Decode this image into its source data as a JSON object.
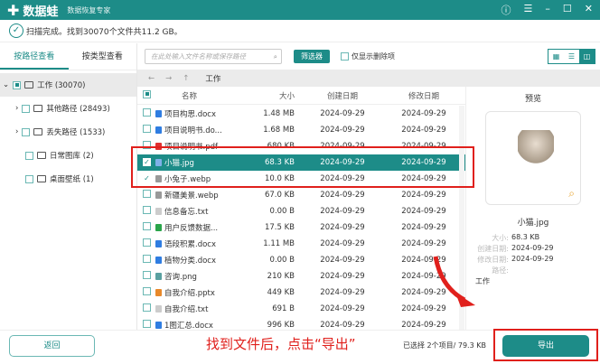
{
  "app": {
    "name": "数据蛙",
    "subtitle": "数据恢复专家"
  },
  "status": "扫描完成。找到30070个文件共11.2 GB。",
  "tabs": [
    "按路径查看",
    "按类型查看"
  ],
  "tree": [
    {
      "label": "工作 (30070)"
    },
    {
      "label": "其他路径 (28493)"
    },
    {
      "label": "丢失路径 (1533)"
    },
    {
      "label": "日常图库 (2)"
    },
    {
      "label": "桌面壁纸 (1)"
    }
  ],
  "toolbar": {
    "search_placeholder": "在此处输入文件名称或保存路径",
    "filter": "筛选器",
    "only_deleted": "仅显示删除项"
  },
  "breadcrumb": "工作",
  "columns": [
    "名称",
    "大小",
    "创建日期",
    "修改日期"
  ],
  "files": [
    {
      "name": "项目构思.docx",
      "size": "1.48 MB",
      "created": "2024-09-29",
      "modified": "2024-09-29",
      "color": "#2f7de1",
      "checked": false
    },
    {
      "name": "项目说明书.do...",
      "size": "1.68 MB",
      "created": "2024-09-29",
      "modified": "2024-09-29",
      "color": "#2f7de1",
      "checked": false
    },
    {
      "name": "项目说明书.pdf",
      "size": "680 KB",
      "created": "2024-09-29",
      "modified": "2024-09-29",
      "color": "#e03030",
      "checked": false
    },
    {
      "name": "小猫.jpg",
      "size": "68.3 KB",
      "created": "2024-09-29",
      "modified": "2024-09-29",
      "color": "#7fb0e8",
      "checked": true
    },
    {
      "name": "小兔子.webp",
      "size": "10.0 KB",
      "created": "2024-09-29",
      "modified": "2024-09-29",
      "color": "#999",
      "checked": true
    },
    {
      "name": "新疆美景.webp",
      "size": "67.0 KB",
      "created": "2024-09-29",
      "modified": "2024-09-29",
      "color": "#999",
      "checked": false
    },
    {
      "name": "信息备忘.txt",
      "size": "0.00  B",
      "created": "2024-09-29",
      "modified": "2024-09-29",
      "color": "#ccc",
      "checked": false
    },
    {
      "name": "用户反馈数据...",
      "size": "17.5 KB",
      "created": "2024-09-29",
      "modified": "2024-09-29",
      "color": "#2aa54a",
      "checked": false
    },
    {
      "name": "语段积累.docx",
      "size": "1.11 MB",
      "created": "2024-09-29",
      "modified": "2024-09-29",
      "color": "#2f7de1",
      "checked": false
    },
    {
      "name": "植物分类.docx",
      "size": "0.00  B",
      "created": "2024-09-29",
      "modified": "2024-09-29",
      "color": "#2f7de1",
      "checked": false
    },
    {
      "name": "咨询.png",
      "size": "210 KB",
      "created": "2024-09-29",
      "modified": "2024-09-29",
      "color": "#5aa0a0",
      "checked": false
    },
    {
      "name": "自我介绍.pptx",
      "size": "449 KB",
      "created": "2024-09-29",
      "modified": "2024-09-29",
      "color": "#e8892b",
      "checked": false
    },
    {
      "name": "自我介绍.txt",
      "size": "691  B",
      "created": "2024-09-29",
      "modified": "2024-09-29",
      "color": "#ccc",
      "checked": false
    },
    {
      "name": "1图汇总.docx",
      "size": "996 KB",
      "created": "2024-09-29",
      "modified": "2024-09-29",
      "color": "#2f7de1",
      "checked": false
    }
  ],
  "preview": {
    "title": "预览",
    "name": "小猫.jpg",
    "labels": {
      "size": "大小:",
      "created": "创建日期:",
      "modified": "修改日期:",
      "path": "路径:"
    },
    "size": "68.3 KB",
    "created": "2024-09-29",
    "modified": "2024-09-29",
    "path": "工作"
  },
  "bottom": {
    "back": "返回",
    "annotation": "找到文件后，点击“导出”",
    "selection": "已选择 2个项目/ 79.3 KB",
    "export": "导出"
  }
}
